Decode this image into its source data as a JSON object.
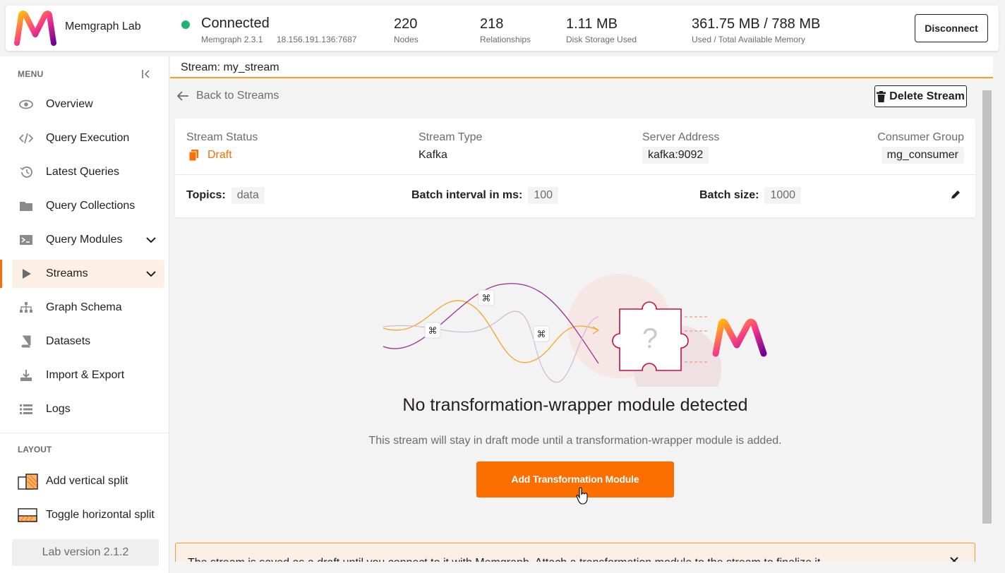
{
  "header": {
    "app_name": "Memgraph Lab",
    "connection": {
      "status": "Connected",
      "version": "Memgraph 2.3.1",
      "host": "18.156.191.136:7687",
      "status_color": "#1fb56f"
    },
    "stats": [
      {
        "value": "220",
        "label": "Nodes"
      },
      {
        "value": "218",
        "label": "Relationships"
      },
      {
        "value": "1.11 MB",
        "label": "Disk Storage Used"
      },
      {
        "value": "361.75 MB / 788 MB",
        "label": "Used / Total Available Memory"
      }
    ],
    "disconnect_label": "Disconnect"
  },
  "sidebar": {
    "menu_title": "MENU",
    "items": [
      {
        "label": "Overview",
        "icon": "eye-icon"
      },
      {
        "label": "Query Execution",
        "icon": "code-icon"
      },
      {
        "label": "Latest Queries",
        "icon": "history-icon"
      },
      {
        "label": "Query Collections",
        "icon": "folder-icon"
      },
      {
        "label": "Query Modules",
        "icon": "terminal-icon"
      },
      {
        "label": "Streams",
        "icon": "play-icon"
      },
      {
        "label": "Graph Schema",
        "icon": "sitemap-icon"
      },
      {
        "label": "Datasets",
        "icon": "book-icon"
      },
      {
        "label": "Import & Export",
        "icon": "download-icon"
      },
      {
        "label": "Logs",
        "icon": "list-icon"
      }
    ],
    "active_item": "Streams",
    "layout_title": "LAYOUT",
    "layout_items": [
      {
        "label": "Add vertical split",
        "icon": "vertical-split-icon"
      },
      {
        "label": "Toggle horizontal split",
        "icon": "horizontal-split-icon"
      }
    ],
    "lab_version": "Lab version 2.1.2"
  },
  "main": {
    "tab_title": "Stream: my_stream",
    "back_label": "Back to Streams",
    "delete_label": "Delete Stream",
    "info": {
      "status_label": "Stream Status",
      "status_value": "Draft",
      "type_label": "Stream Type",
      "type_value": "Kafka",
      "server_label": "Server Address",
      "server_value": "kafka:9092",
      "group_label": "Consumer Group",
      "group_value": "mg_consumer",
      "topics_label": "Topics:",
      "topics_value": "data",
      "batch_interval_label": "Batch interval in ms:",
      "batch_interval_value": "100",
      "batch_size_label": "Batch size:",
      "batch_size_value": "1000"
    },
    "empty_title": "No transformation-wrapper module detected",
    "empty_desc": "This stream will stay in draft mode until a transformation-wrapper module is added.",
    "add_button": "Add Transformation Module",
    "warning_text": "The stream is saved as a draft until you connect to it with Memgraph. Attach a transformation module to the stream to finalize it."
  },
  "colors": {
    "accent": "#fb6e00",
    "accent_light": "#fcefe6",
    "active_bg": "#fcefe6",
    "text": "#231f20",
    "muted": "#6c6c6c"
  }
}
